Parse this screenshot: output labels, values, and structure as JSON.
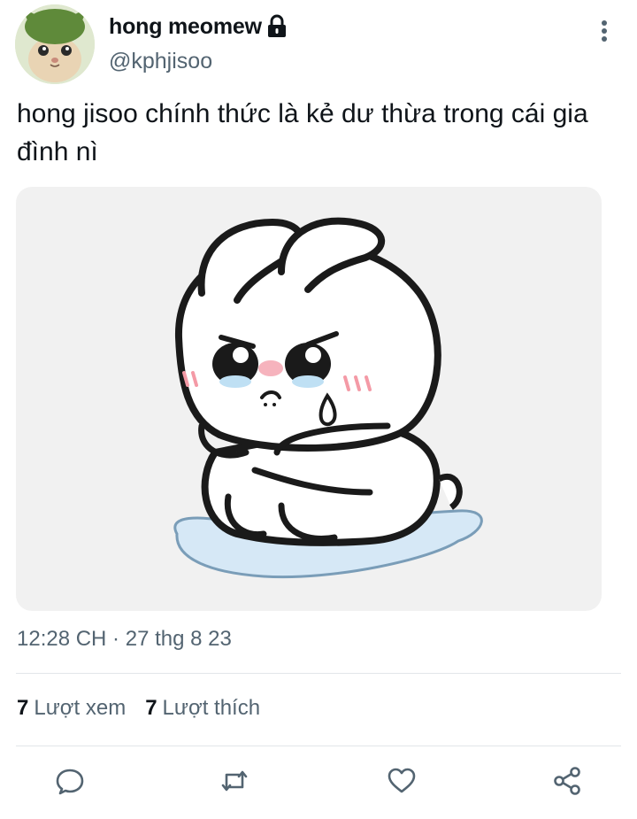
{
  "user": {
    "display_name": "hong meomew",
    "handle": "@kphjisoo",
    "protected": true
  },
  "tweet": {
    "text": "hong jisoo chính thức là kẻ dư thừa trong cái gia đình nì",
    "timestamp": "12:28 CH · 27 thg 8 23"
  },
  "stats": {
    "views_count": "7",
    "views_label": "Lượt xem",
    "likes_count": "7",
    "likes_label": "Lượt thích"
  },
  "actions": [
    "reply-icon",
    "retweet-icon",
    "like-icon",
    "share-icon"
  ],
  "colors": {
    "primary_text": "#0f1419",
    "secondary_text": "#536471",
    "divider": "#e2e6e9",
    "media_background": "#f1f1f1"
  }
}
